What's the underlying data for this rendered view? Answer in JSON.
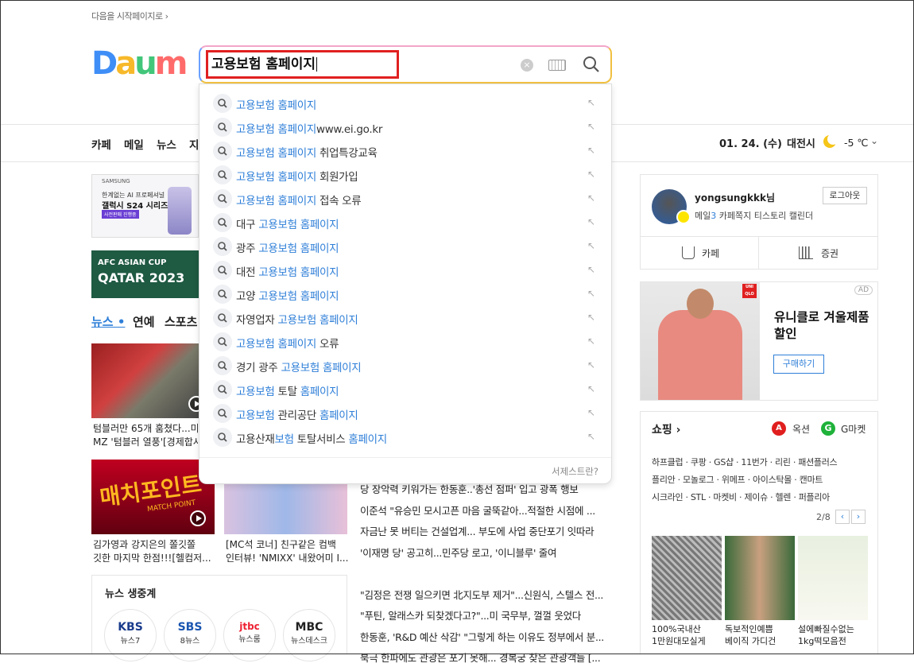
{
  "header": {
    "start_page_link": "다음을 시작페이지로 ›"
  },
  "logo": {
    "letters": [
      "D",
      "a",
      "u",
      "m"
    ],
    "colors": [
      "#3f8ef7",
      "#f7b92a",
      "#42c67a",
      "#ff6b6b"
    ]
  },
  "search": {
    "query": "고용보험 홈페이지",
    "suggestions": [
      {
        "hl1": "고용보험 홈페이지",
        "rest": "",
        "pre": ""
      },
      {
        "hl1": "고용보험 홈페이지",
        "rest": "www.ei.go.kr",
        "pre": ""
      },
      {
        "hl1": "고용보험 홈페이지",
        "rest": " 취업특강교육",
        "pre": ""
      },
      {
        "hl1": "고용보험 홈페이지",
        "rest": " 회원가입",
        "pre": ""
      },
      {
        "hl1": "고용보험 홈페이지",
        "rest": " 접속 오류",
        "pre": ""
      },
      {
        "pre": "대구 ",
        "hl1": "고용보험 홈페이지",
        "rest": ""
      },
      {
        "pre": "광주 ",
        "hl1": "고용보험 홈페이지",
        "rest": ""
      },
      {
        "pre": "대전 ",
        "hl1": "고용보험 홈페이지",
        "rest": ""
      },
      {
        "pre": "고양 ",
        "hl1": "고용보험 홈페이지",
        "rest": ""
      },
      {
        "pre": "자영업자 ",
        "hl1": "고용보험 홈페이지",
        "rest": ""
      },
      {
        "pre": "",
        "hl1": "고용보험 홈페이지",
        "rest": " 오류"
      },
      {
        "pre": "경기 광주 ",
        "hl1": "고용보험 홈페이지",
        "rest": ""
      },
      {
        "pre": "",
        "hl1": "고용보험",
        "rest": " 토탈 ",
        "hl2": "홈페이지"
      },
      {
        "pre": "",
        "hl1": "고용보험",
        "rest": " 관리공단 ",
        "hl2": "홈페이지"
      },
      {
        "pre": "고용산재",
        "hl1": "보험",
        "rest": " 토탈서비스 ",
        "hl2": "홈페이지"
      }
    ],
    "footer": "서제스트란?"
  },
  "nav": {
    "items": [
      "카페",
      "메일",
      "뉴스",
      "지"
    ],
    "date": "01. 24. (수)",
    "city": "대전시",
    "temp": "-5 ℃"
  },
  "ads": {
    "samsung": {
      "brand": "SAMSUNG",
      "line1": "한계없는 AI 프로페셔널",
      "line2": "갤럭시 S24 시리즈",
      "tag": "사전판매 진행중"
    },
    "afc": {
      "line1": "AFC ASIAN CUP",
      "line2": "QATAR 2023"
    }
  },
  "news_tabs": [
    "뉴스 •",
    "연예",
    "스포츠"
  ],
  "captions": {
    "c1a": "텀블러만 65개 훔쳤다...미",
    "c1b": "MZ '텀블러 열풍'[경제합시",
    "c2a": "김가영과 강지은의 쫄깃쫄",
    "c2b": "깃한 마지막 한점!!![헬컴저...",
    "c3a": "[MC석 코너] 친구같은 컴백",
    "c3b": "인터뷰! 'NMIXX' 내왔어미 I...",
    "thumb2_big": "매치포인트",
    "thumb2_small": "MATCH POINT"
  },
  "news_list": [
    "당 장악력 키워가는 한동훈..'총선 점퍼' 입고 광폭 행보",
    "이준석 \"유승민 모시고픈 마음 굴뚝같아...적절한 시점에 ...",
    "자금난 못 버티는 건설업계... 부도에 사업 중단포기 잇따라",
    "'이재명 당' 공고히...민주당 로고, '이니블루' 줄여",
    "",
    "\"김정은 전쟁 일으키면 北지도부 제거\"...신원식, 스텔스 전...",
    "\"푸틴, 알래스카 되찾겠다고?\"...미 국무부, 껄껄 웃었다",
    "한동훈, 'R&D 예산 삭감' \"그렇게 하는 이유도 정부에서 분...",
    "북극 한파에도 관광은 포기 못해... 경복궁 찾은 관광객들 [..."
  ],
  "live": {
    "title": "뉴스 생중계",
    "channels": [
      {
        "name": "KBS",
        "show": "뉴스7"
      },
      {
        "name": "SBS",
        "show": "8뉴스"
      },
      {
        "name": "jtbc",
        "show": "뉴스룸"
      },
      {
        "name": "MBC",
        "show": "뉴스데스크"
      }
    ]
  },
  "profile": {
    "username": "yongsungkkk님",
    "logout": "로그아웃",
    "mail_label": "메일",
    "mail_count": "3",
    "links": "카페쪽지  티스토리  캘린더",
    "cafe": "카페",
    "stock": "증권"
  },
  "uniqlo": {
    "brand": "UNI QLO",
    "ad": "AD",
    "headline": "유니클로 겨울제품 할인",
    "button": "구매하기"
  },
  "shopping": {
    "title": "쇼핑 ›",
    "auction": "옥션",
    "gmarket": "G마켓",
    "malls": [
      "하프클럽 · 쿠팡 · GS샵 · 11번가 · 리린 · 패션플러스",
      "플리안 · 모놀로그 · 위메프 · 아이스탁몰 · 캔마트",
      "시크라인 · STL · 마켓비 · 제이슈 · 헬렌 · 퍼플리아"
    ],
    "page": "2/8",
    "products": [
      {
        "name": "100%국내산",
        "name2": "1만원대모실게"
      },
      {
        "name": "독보적인예쁨",
        "name2": "베이직 가디건"
      },
      {
        "name": "설에빠질수없는",
        "name2": "1kg떡모음전"
      }
    ]
  }
}
